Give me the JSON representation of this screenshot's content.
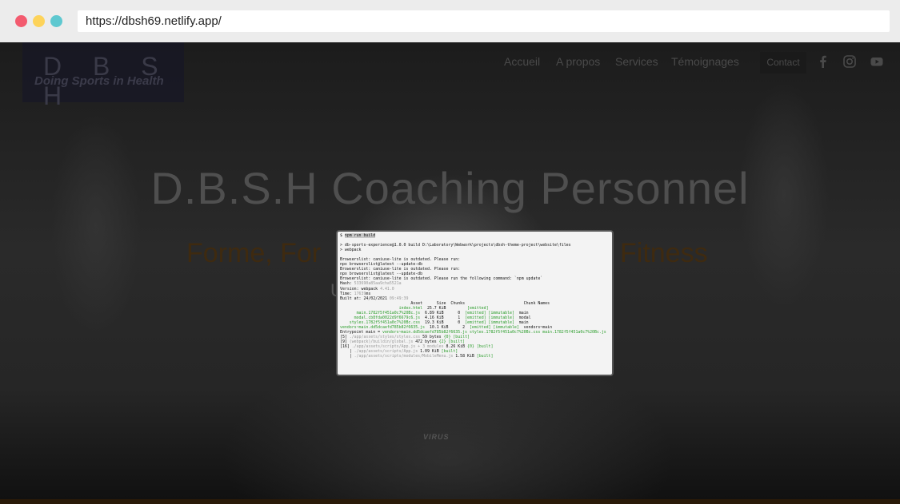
{
  "browser": {
    "url": "https://dbsh69.netlify.app/"
  },
  "site": {
    "logo": {
      "letters": "D B S H",
      "tagline": "Doing Sports in Health"
    },
    "nav": [
      "Accueil",
      "A propos",
      "Services",
      "Témoignages"
    ],
    "contact_label": "Contact",
    "social": [
      "facebook-icon",
      "instagram-icon",
      "youtube-icon"
    ],
    "hero_title": "D.B.S.H Coaching Personnel",
    "hero_sub_left": "Forme, For",
    "hero_sub_right": "Fitness",
    "hero_u": "U",
    "shirt_brand": "VIRUS"
  },
  "terminal": {
    "prompt": "$ ",
    "command": "npm run build",
    "lines": [
      "",
      "> db-sports-experience@1.0.0 build D:\\Laboratory\\Webwork\\projects\\dbsh-theme-project\\website\\files",
      "> webpack",
      "",
      "Browserslist: caniuse-lite is outdated. Please run:",
      "npx browserslist@latest --update-db",
      "Browserslist: caniuse-lite is outdated. Please run:",
      "npx browserslist@latest --update-db",
      "Browserslist: caniuse-lite is outdated. Please run the following command: `npm update`"
    ],
    "hash_label": "Hash: ",
    "hash": "533690a85aa9cha5521a",
    "version_label": "Version: webpack ",
    "version": "4.41.0",
    "time_label": "Time: ",
    "time": "17639",
    "time_unit": "ms",
    "built_label": "Built at: 24/02/2021 ",
    "built_time": "09:49:39",
    "header": "                              Asset      Size  Chunks                         Chunk Names",
    "assets": [
      {
        "name": "                         index.html",
        "size": "  25.7 KiB",
        "chunk": "         ",
        "tags": "[emitted]",
        "names": ""
      },
      {
        "name": "       main.1782f5f451a0c7%20Bc.js",
        "size": "  6.89 KiB",
        "chunk": "      0  ",
        "tags": "[emitted] [immutable]",
        "names": "  main"
      },
      {
        "name": "      modal.cb8fda0022d9f6679c6.js",
        "size": "  4.16 KiB",
        "chunk": "      1  ",
        "tags": "[emitted] [immutable]",
        "names": "  modal"
      },
      {
        "name": "    styles.1782f5f451a0c7%20Bc.css",
        "size": "  19.3 KiB",
        "chunk": "      0  ",
        "tags": "[emitted] [immutable]",
        "names": "  main"
      },
      {
        "name": "vendors~main.dd5dcaefd785b82f6635.js",
        "size": "  10.1 KiB",
        "chunk": "      2  ",
        "tags": "[emitted] [immutable]",
        "names": "  vendors~main"
      }
    ],
    "entrypoint_label": "Entrypoint main = ",
    "entrypoint": "vendors~main.dd5dcaefd785b82f6635.js styles.1782f5f451a0c7%20Bc.css main.1782f5f451a0c7%20Bc.js",
    "modules": [
      {
        "id": "[5] ",
        "path": "./app/assets/styles/styles.css",
        "size": " 59 bytes ",
        "chunk": "{0}",
        "status": " [built]"
      },
      {
        "id": "[9] ",
        "path": "(webpack)/buildin/global.js",
        "size": " 472 bytes ",
        "chunk": "{2}",
        "status": " [built]"
      },
      {
        "id": "[16] ",
        "path": "./app/assets/scripts/App.js + 3 modules",
        "size": " 8.26 KiB ",
        "chunk": "{0}",
        "status": " [built]"
      },
      {
        "id": "    | ",
        "path": "./app/assets/scripts/App.js",
        "size": " 1.09 KiB ",
        "chunk": "",
        "status": "[built]"
      },
      {
        "id": "    | ",
        "path": "./app/assets/scripts/modules/MobileMenu.js",
        "size": " 1.58 KiB ",
        "chunk": "",
        "status": "[built]"
      }
    ]
  }
}
